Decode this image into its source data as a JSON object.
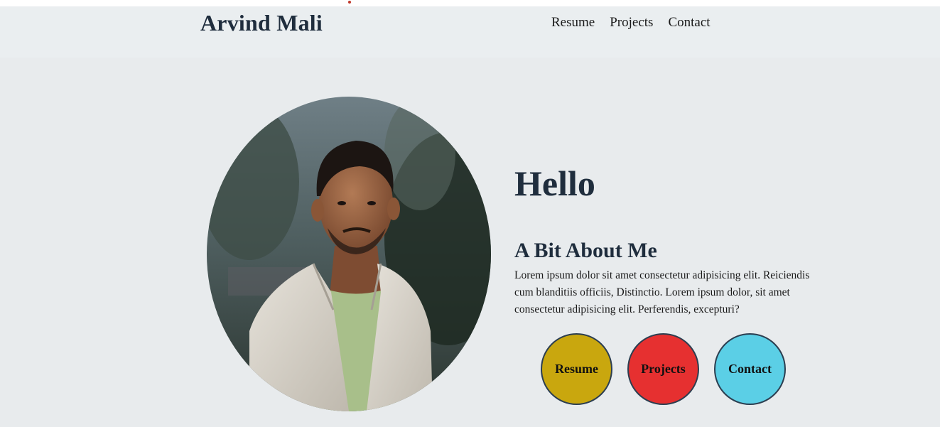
{
  "header": {
    "brand": "Arvind Mali",
    "nav": [
      "Resume",
      "Projects",
      "Contact"
    ]
  },
  "hero": {
    "greeting": "Hello",
    "about_title": "A Bit About Me",
    "about_text": "Lorem ipsum dolor sit amet consectetur adipisicing elit. Reiciendis cum blanditiis officiis, Distinctio. Lorem ipsum dolor, sit amet consectetur adipisicing elit. Perferendis, excepturi?",
    "buttons": [
      {
        "label": "Resume",
        "color": "#c9a70e"
      },
      {
        "label": "Projects",
        "color": "#e63030"
      },
      {
        "label": "Contact",
        "color": "#5bcfe6"
      }
    ]
  },
  "colors": {
    "header_bg": "#eaeef0",
    "main_bg": "#e8ebed",
    "heading": "#1f2d3d"
  }
}
